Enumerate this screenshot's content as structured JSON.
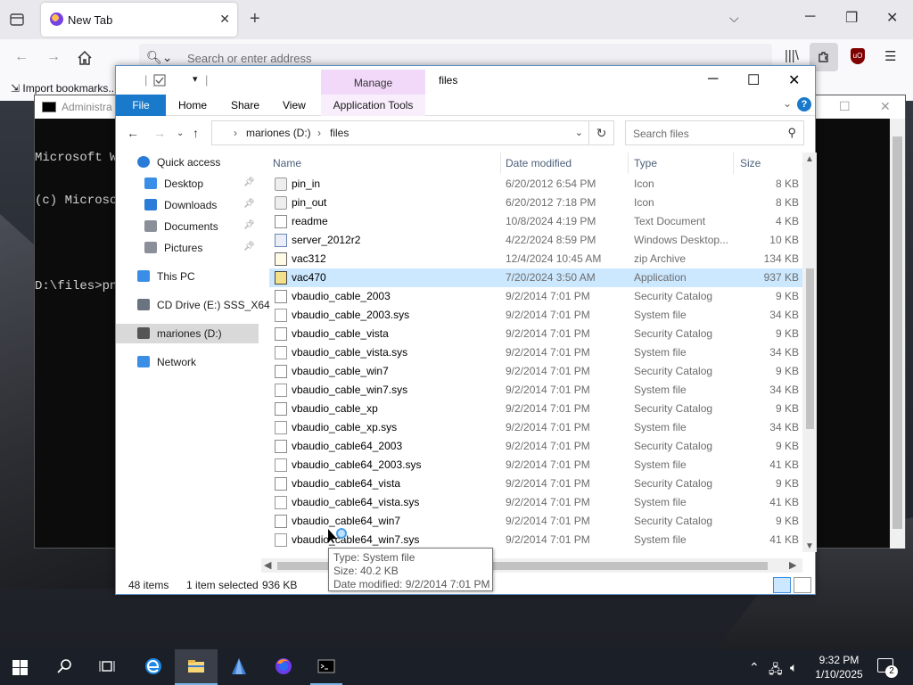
{
  "browser": {
    "tab_title": "New Tab",
    "address_placeholder": "Search or enter address",
    "bookmark_import": "Import bookmarks..."
  },
  "cmd": {
    "title": "Administra",
    "lines": [
      "Microsoft W",
      "(c) Microso",
      "",
      "D:\\files>pn"
    ]
  },
  "explorer": {
    "window_title": "files",
    "manage_label": "Manage",
    "ribbon_tabs": [
      "File",
      "Home",
      "Share",
      "View"
    ],
    "app_tools_label": "Application Tools",
    "breadcrumb": [
      "mariones (D:)",
      "files"
    ],
    "search_placeholder": "Search files",
    "columns": {
      "name": "Name",
      "date": "Date modified",
      "type": "Type",
      "size": "Size"
    },
    "sidebar": [
      {
        "label": "Quick access",
        "icon": "star-icon",
        "pinned": false
      },
      {
        "label": "Desktop",
        "icon": "desktop-icon",
        "pinned": true
      },
      {
        "label": "Downloads",
        "icon": "download-icon",
        "pinned": true
      },
      {
        "label": "Documents",
        "icon": "documents-icon",
        "pinned": true
      },
      {
        "label": "Pictures",
        "icon": "pictures-icon",
        "pinned": true
      },
      {
        "label": "This PC",
        "icon": "computer-icon",
        "pinned": false
      },
      {
        "label": "CD Drive (E:) SSS_X64",
        "icon": "cd-drive-icon",
        "pinned": false
      },
      {
        "label": "mariones (D:)",
        "icon": "network-drive-icon",
        "pinned": false,
        "selected": true
      },
      {
        "label": "Network",
        "icon": "network-icon",
        "pinned": false
      }
    ],
    "files": [
      {
        "name": "pin_in",
        "date": "6/20/2012 6:54 PM",
        "type": "Icon",
        "size": "8 KB",
        "kind": "icon"
      },
      {
        "name": "pin_out",
        "date": "6/20/2012 7:18 PM",
        "type": "Icon",
        "size": "8 KB",
        "kind": "icon"
      },
      {
        "name": "readme",
        "date": "10/8/2024 4:19 PM",
        "type": "Text Document",
        "size": "4 KB",
        "kind": "doc"
      },
      {
        "name": "server_2012r2",
        "date": "4/22/2024 8:59 PM",
        "type": "Windows Desktop...",
        "size": "10 KB",
        "kind": "win"
      },
      {
        "name": "vac312",
        "date": "12/4/2024 10:45 AM",
        "type": "zip Archive",
        "size": "134 KB",
        "kind": "zip"
      },
      {
        "name": "vac470",
        "date": "7/20/2024 3:50 AM",
        "type": "Application",
        "size": "937 KB",
        "kind": "app",
        "selected": true
      },
      {
        "name": "vbaudio_cable_2003",
        "date": "9/2/2014 7:01 PM",
        "type": "Security Catalog",
        "size": "9 KB",
        "kind": "cat"
      },
      {
        "name": "vbaudio_cable_2003.sys",
        "date": "9/2/2014 7:01 PM",
        "type": "System file",
        "size": "34 KB",
        "kind": "sys"
      },
      {
        "name": "vbaudio_cable_vista",
        "date": "9/2/2014 7:01 PM",
        "type": "Security Catalog",
        "size": "9 KB",
        "kind": "cat"
      },
      {
        "name": "vbaudio_cable_vista.sys",
        "date": "9/2/2014 7:01 PM",
        "type": "System file",
        "size": "34 KB",
        "kind": "sys"
      },
      {
        "name": "vbaudio_cable_win7",
        "date": "9/2/2014 7:01 PM",
        "type": "Security Catalog",
        "size": "9 KB",
        "kind": "cat"
      },
      {
        "name": "vbaudio_cable_win7.sys",
        "date": "9/2/2014 7:01 PM",
        "type": "System file",
        "size": "34 KB",
        "kind": "sys"
      },
      {
        "name": "vbaudio_cable_xp",
        "date": "9/2/2014 7:01 PM",
        "type": "Security Catalog",
        "size": "9 KB",
        "kind": "cat"
      },
      {
        "name": "vbaudio_cable_xp.sys",
        "date": "9/2/2014 7:01 PM",
        "type": "System file",
        "size": "34 KB",
        "kind": "sys"
      },
      {
        "name": "vbaudio_cable64_2003",
        "date": "9/2/2014 7:01 PM",
        "type": "Security Catalog",
        "size": "9 KB",
        "kind": "cat"
      },
      {
        "name": "vbaudio_cable64_2003.sys",
        "date": "9/2/2014 7:01 PM",
        "type": "System file",
        "size": "41 KB",
        "kind": "sys"
      },
      {
        "name": "vbaudio_cable64_vista",
        "date": "9/2/2014 7:01 PM",
        "type": "Security Catalog",
        "size": "9 KB",
        "kind": "cat"
      },
      {
        "name": "vbaudio_cable64_vista.sys",
        "date": "9/2/2014 7:01 PM",
        "type": "System file",
        "size": "41 KB",
        "kind": "sys"
      },
      {
        "name": "vbaudio_cable64_win7",
        "date": "9/2/2014 7:01 PM",
        "type": "Security Catalog",
        "size": "9 KB",
        "kind": "cat"
      },
      {
        "name": "vbaudio_cable64_win7.sys",
        "date": "9/2/2014 7:01 PM",
        "type": "System file",
        "size": "41 KB",
        "kind": "sys",
        "hover": true
      }
    ],
    "status": {
      "count": "48 items",
      "selected": "1 item selected",
      "size": "936 KB"
    },
    "tooltip": [
      "Type: System file",
      "Size: 40.2 KB",
      "Date modified: 9/2/2014 7:01 PM"
    ]
  },
  "taskbar": {
    "time": "9:32 PM",
    "date": "1/10/2025",
    "notification_count": "2",
    "apps": [
      "search-icon",
      "task-view-icon",
      "edge-icon",
      "file-explorer-icon",
      "app-icon",
      "firefox-icon",
      "cmd-icon"
    ]
  },
  "colors": {
    "accent": "#1979ca",
    "selection": "#cce8ff",
    "manage_tab": "#f2d9fa",
    "taskbar": "#1b1f28"
  }
}
